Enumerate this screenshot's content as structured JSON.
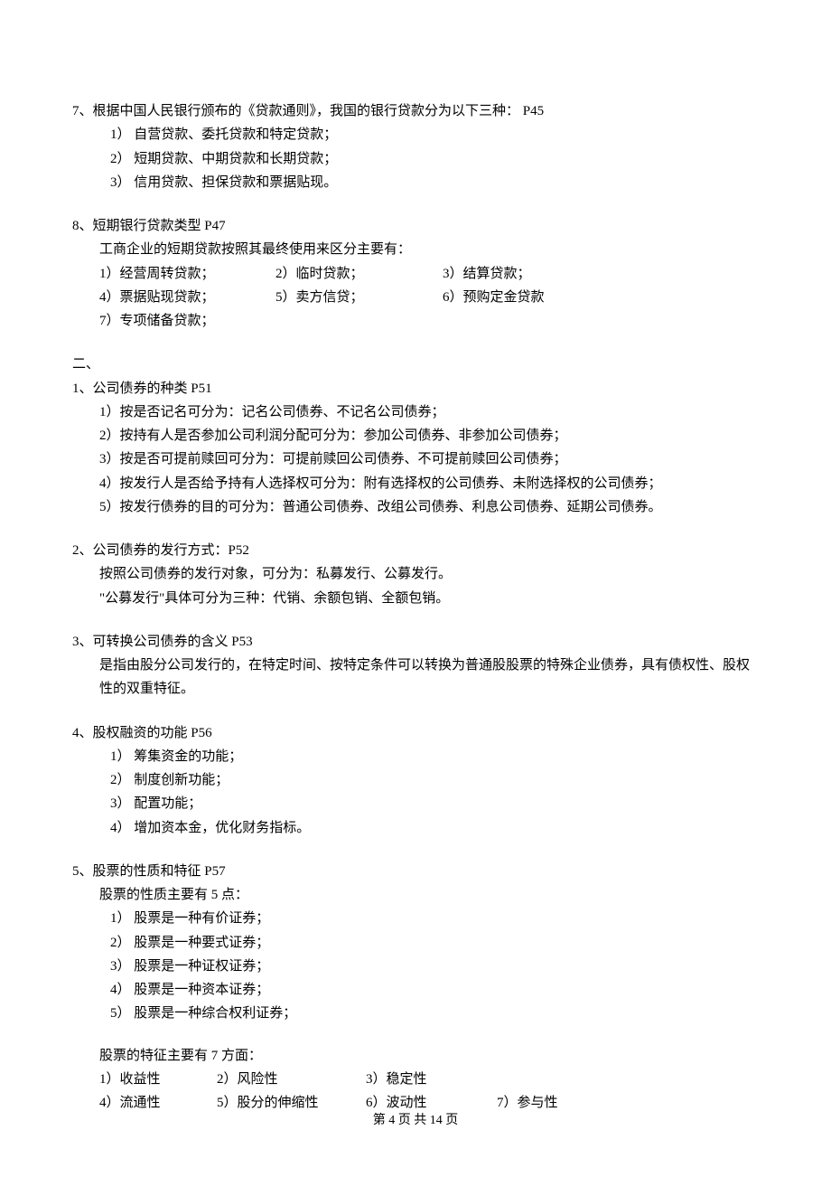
{
  "q7": {
    "num": "7、",
    "title": "根据中国人民银行颁布的《贷款通则》，我国的银行贷款分为以下三种：  P45",
    "items": [
      "1） 自营贷款、委托贷款和特定贷款；",
      "2） 短期贷款、中期贷款和长期贷款；",
      "3） 信用贷款、担保贷款和票据贴现。"
    ]
  },
  "q8": {
    "num": "8、",
    "title": "短期银行贷款类型  P47",
    "sub": "工商企业的短期贷款按照其最终使用来区分主要有：",
    "row1": [
      "1）经营周转贷款；",
      "2）临时贷款；",
      "3）结算贷款；"
    ],
    "row2": [
      "4）票据贴现贷款；",
      "5）卖方信贷；",
      "6）预购定金贷款"
    ],
    "row3": "7）专项储备贷款；"
  },
  "sec2_mark": "二、",
  "s2_q1": {
    "num": "1、",
    "title": "公司债券的种类  P51",
    "items": [
      "1）按是否记名可分为：记名公司债券、不记名公司债券；",
      "2）按持有人是否参加公司利润分配可分为：参加公司债券、非参加公司债券；",
      "3）按是否可提前赎回可分为：可提前赎回公司债券、不可提前赎回公司债券；",
      "4）按发行人是否给予持有人选择权可分为：附有选择权的公司债券、未附选择权的公司债券；",
      "5）按发行债券的目的可分为：普通公司债券、改组公司债券、利息公司债券、延期公司债券。"
    ]
  },
  "s2_q2": {
    "num": "2、",
    "title": "公司债券的发行方式：P52",
    "lines": [
      "按照公司债券的发行对象，可分为：私募发行、公募发行。",
      "\"公募发行\"具体可分为三种：代销、余额包销、全额包销。"
    ]
  },
  "s2_q3": {
    "num": "3、",
    "title": "可转换公司债券的含义  P53",
    "lines": [
      "是指由股分公司发行的，在特定时间、按特定条件可以转换为普通股股票的特殊企业债券，具有债权性、股权性的双重特征。"
    ]
  },
  "s2_q4": {
    "num": "4、",
    "title": "股权融资的功能  P56",
    "items": [
      "1） 筹集资金的功能；",
      "2） 制度创新功能；",
      "3） 配置功能；",
      "4） 增加资本金，优化财务指标。"
    ]
  },
  "s2_q5": {
    "num": "5、",
    "title": "股票的性质和特征  P57",
    "sub1": "股票的性质主要有 5 点：",
    "items": [
      "1） 股票是一种有价证券；",
      "2） 股票是一种要式证券；",
      "3） 股票是一种证权证券；",
      "4） 股票是一种资本证券；",
      "5） 股票是一种综合权利证券；"
    ],
    "sub2": "股票的特征主要有 7 方面：",
    "frow1": [
      "1）收益性",
      "2）风险性",
      "3）稳定性",
      ""
    ],
    "frow2": [
      "4）流通性",
      "5）股分的伸缩性",
      "6）波动性",
      "7）参与性"
    ]
  },
  "footer": "第 4 页 共 14 页"
}
